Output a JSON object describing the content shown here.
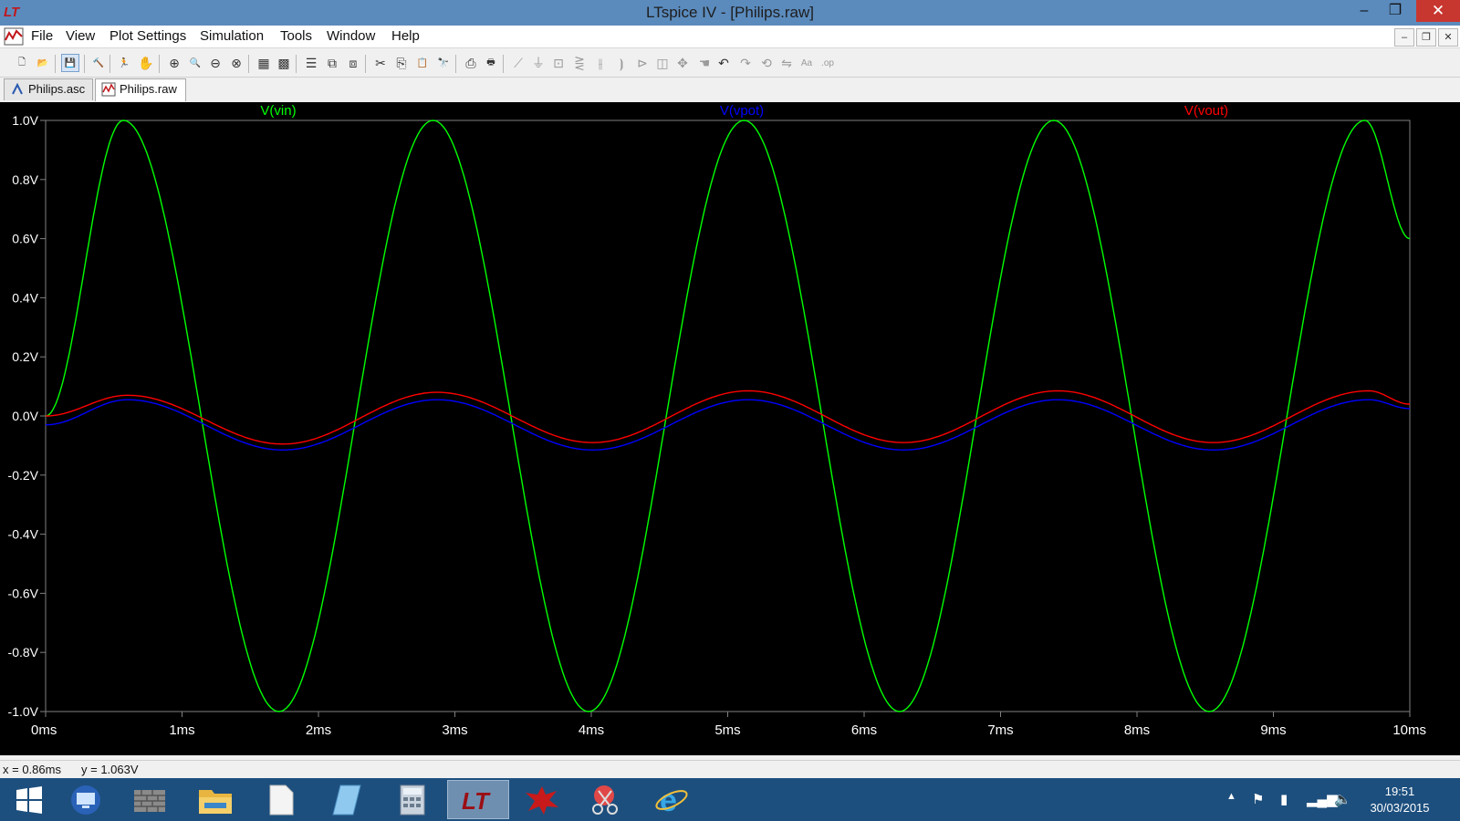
{
  "window": {
    "title": "LTspice IV - [Philips.raw]",
    "controls": {
      "minimize": "–",
      "restore": "❐",
      "close": "✕"
    }
  },
  "menubar": {
    "items": [
      "File",
      "View",
      "Plot Settings",
      "Simulation",
      "Tools",
      "Window",
      "Help"
    ],
    "mdi_controls": {
      "minimize": "–",
      "restore": "❐",
      "close": "✕"
    }
  },
  "toolbar": {
    "buttons": [
      {
        "name": "new-schematic-icon",
        "glyph": "🗋",
        "state": "enabled"
      },
      {
        "name": "open-icon",
        "glyph": "📂",
        "state": "enabled"
      },
      {
        "name": "save-icon",
        "glyph": "💾",
        "state": "pressed"
      },
      {
        "name": "control-panel-icon",
        "glyph": "🔨",
        "state": "enabled"
      },
      {
        "name": "run-icon",
        "glyph": "🏃",
        "state": "enabled"
      },
      {
        "name": "halt-icon",
        "glyph": "✋",
        "state": "dim"
      },
      {
        "name": "zoom-in-icon",
        "glyph": "⊕",
        "state": "enabled"
      },
      {
        "name": "zoom-pan-icon",
        "glyph": "🔍",
        "state": "enabled"
      },
      {
        "name": "zoom-out-icon",
        "glyph": "⊖",
        "state": "enabled"
      },
      {
        "name": "zoom-fit-icon",
        "glyph": "⊗",
        "state": "enabled"
      },
      {
        "name": "autorange-icon",
        "glyph": "▦",
        "state": "enabled"
      },
      {
        "name": "grid-icon",
        "glyph": "▩",
        "state": "enabled"
      },
      {
        "name": "tile-horizontal-icon",
        "glyph": "☰",
        "state": "enabled"
      },
      {
        "name": "cascade-icon",
        "glyph": "⧉",
        "state": "enabled"
      },
      {
        "name": "tile-vertical-icon",
        "glyph": "⧈",
        "state": "enabled"
      },
      {
        "name": "cut-icon",
        "glyph": "✂",
        "state": "enabled"
      },
      {
        "name": "copy-icon",
        "glyph": "⎘",
        "state": "enabled"
      },
      {
        "name": "paste-icon",
        "glyph": "📋",
        "state": "enabled"
      },
      {
        "name": "find-icon",
        "glyph": "🔭",
        "state": "enabled"
      },
      {
        "name": "print-preview-icon",
        "glyph": "⎙",
        "state": "enabled"
      },
      {
        "name": "print-icon",
        "glyph": "🖶",
        "state": "enabled"
      },
      {
        "name": "wire-icon",
        "glyph": "⟋",
        "state": "dim"
      },
      {
        "name": "ground-icon",
        "glyph": "⏚",
        "state": "dim"
      },
      {
        "name": "label-net-icon",
        "glyph": "⊡",
        "state": "dim"
      },
      {
        "name": "resistor-icon",
        "glyph": "⋛",
        "state": "dim"
      },
      {
        "name": "capacitor-icon",
        "glyph": "⫲",
        "state": "dim"
      },
      {
        "name": "inductor-icon",
        "glyph": "⦘",
        "state": "dim"
      },
      {
        "name": "diode-icon",
        "glyph": "⊳",
        "state": "dim"
      },
      {
        "name": "component-icon",
        "glyph": "◫",
        "state": "dim"
      },
      {
        "name": "move-icon",
        "glyph": "✥",
        "state": "dim"
      },
      {
        "name": "drag-icon",
        "glyph": "☚",
        "state": "dim"
      },
      {
        "name": "undo-icon",
        "glyph": "↶",
        "state": "enabled"
      },
      {
        "name": "redo-icon",
        "glyph": "↷",
        "state": "dim"
      },
      {
        "name": "rotate-icon",
        "glyph": "⟲",
        "state": "dim"
      },
      {
        "name": "mirror-icon",
        "glyph": "⇋",
        "state": "dim"
      },
      {
        "name": "text-icon",
        "glyph": "Aa",
        "state": "dim"
      },
      {
        "name": "spice-directive-icon",
        "glyph": ".op",
        "state": "dim"
      }
    ]
  },
  "tabs": [
    {
      "label": "Philips.asc",
      "active": false,
      "icon": "schematic-icon"
    },
    {
      "label": "Philips.raw",
      "active": true,
      "icon": "waveform-icon"
    }
  ],
  "plot_colors": {
    "background": "#000000",
    "grid": "#808080",
    "axis_text": "#ffffff",
    "vin": "#00ff00",
    "vpot": "#0000ff",
    "vout": "#ff0000"
  },
  "chart_data": {
    "type": "line",
    "title": "",
    "xlabel": "",
    "ylabel": "",
    "x_ticks": [
      "0ms",
      "1ms",
      "2ms",
      "3ms",
      "4ms",
      "5ms",
      "6ms",
      "7ms",
      "8ms",
      "9ms",
      "10ms"
    ],
    "y_ticks": [
      "1.0V",
      "0.8V",
      "0.6V",
      "0.4V",
      "0.2V",
      "0.0V",
      "-0.2V",
      "-0.4V",
      "-0.6V",
      "-0.8V",
      "-1.0V"
    ],
    "xlim": [
      0,
      10
    ],
    "ylim": [
      -1.0,
      1.0
    ],
    "grid": false,
    "legend": "top",
    "x_unit": "ms",
    "series": [
      {
        "name": "V(vin)",
        "color": "#00ff00",
        "x": [
          0.0,
          0.57,
          1.71,
          2.84,
          3.98,
          5.12,
          6.26,
          7.39,
          8.53,
          9.67,
          10.0
        ],
        "y": [
          0.0,
          1.0,
          -1.0,
          1.0,
          -1.0,
          1.0,
          -1.0,
          1.0,
          -1.0,
          1.0,
          0.6
        ]
      },
      {
        "name": "V(vpot)",
        "color": "#0000ff",
        "x": [
          0.0,
          0.6,
          1.74,
          2.87,
          4.01,
          5.15,
          6.29,
          7.42,
          8.56,
          9.7,
          10.0
        ],
        "y": [
          -0.03,
          0.055,
          -0.115,
          0.055,
          -0.115,
          0.055,
          -0.115,
          0.055,
          -0.115,
          0.055,
          0.025
        ]
      },
      {
        "name": "V(vout)",
        "color": "#ff0000",
        "x": [
          0.0,
          0.6,
          1.74,
          2.87,
          4.01,
          5.15,
          6.29,
          7.42,
          8.56,
          9.7,
          10.0
        ],
        "y": [
          0.0,
          0.07,
          -0.095,
          0.08,
          -0.09,
          0.085,
          -0.09,
          0.085,
          -0.09,
          0.085,
          0.04
        ]
      }
    ]
  },
  "statusbar": {
    "x_readout": "x = 0.86ms",
    "y_readout": "y = 1.063V"
  },
  "taskbar": {
    "apps": [
      {
        "name": "start-icon",
        "active": false
      },
      {
        "name": "remote-desktop-icon",
        "active": false
      },
      {
        "name": "firewall-icon",
        "active": false
      },
      {
        "name": "file-explorer-icon",
        "active": false
      },
      {
        "name": "blank-document-icon",
        "active": false
      },
      {
        "name": "notepad-icon",
        "active": false
      },
      {
        "name": "calculator-icon",
        "active": false
      },
      {
        "name": "ltspice-icon",
        "active": true
      },
      {
        "name": "splat-app-icon",
        "active": false
      },
      {
        "name": "snipping-tool-icon",
        "active": false
      },
      {
        "name": "internet-explorer-icon",
        "active": false
      }
    ],
    "tray_icons": [
      "show-hidden-icons-icon",
      "action-center-flag-icon",
      "power-icon",
      "network-signal-icon",
      "volume-icon"
    ],
    "time": "19:51",
    "date": "30/03/2015"
  }
}
